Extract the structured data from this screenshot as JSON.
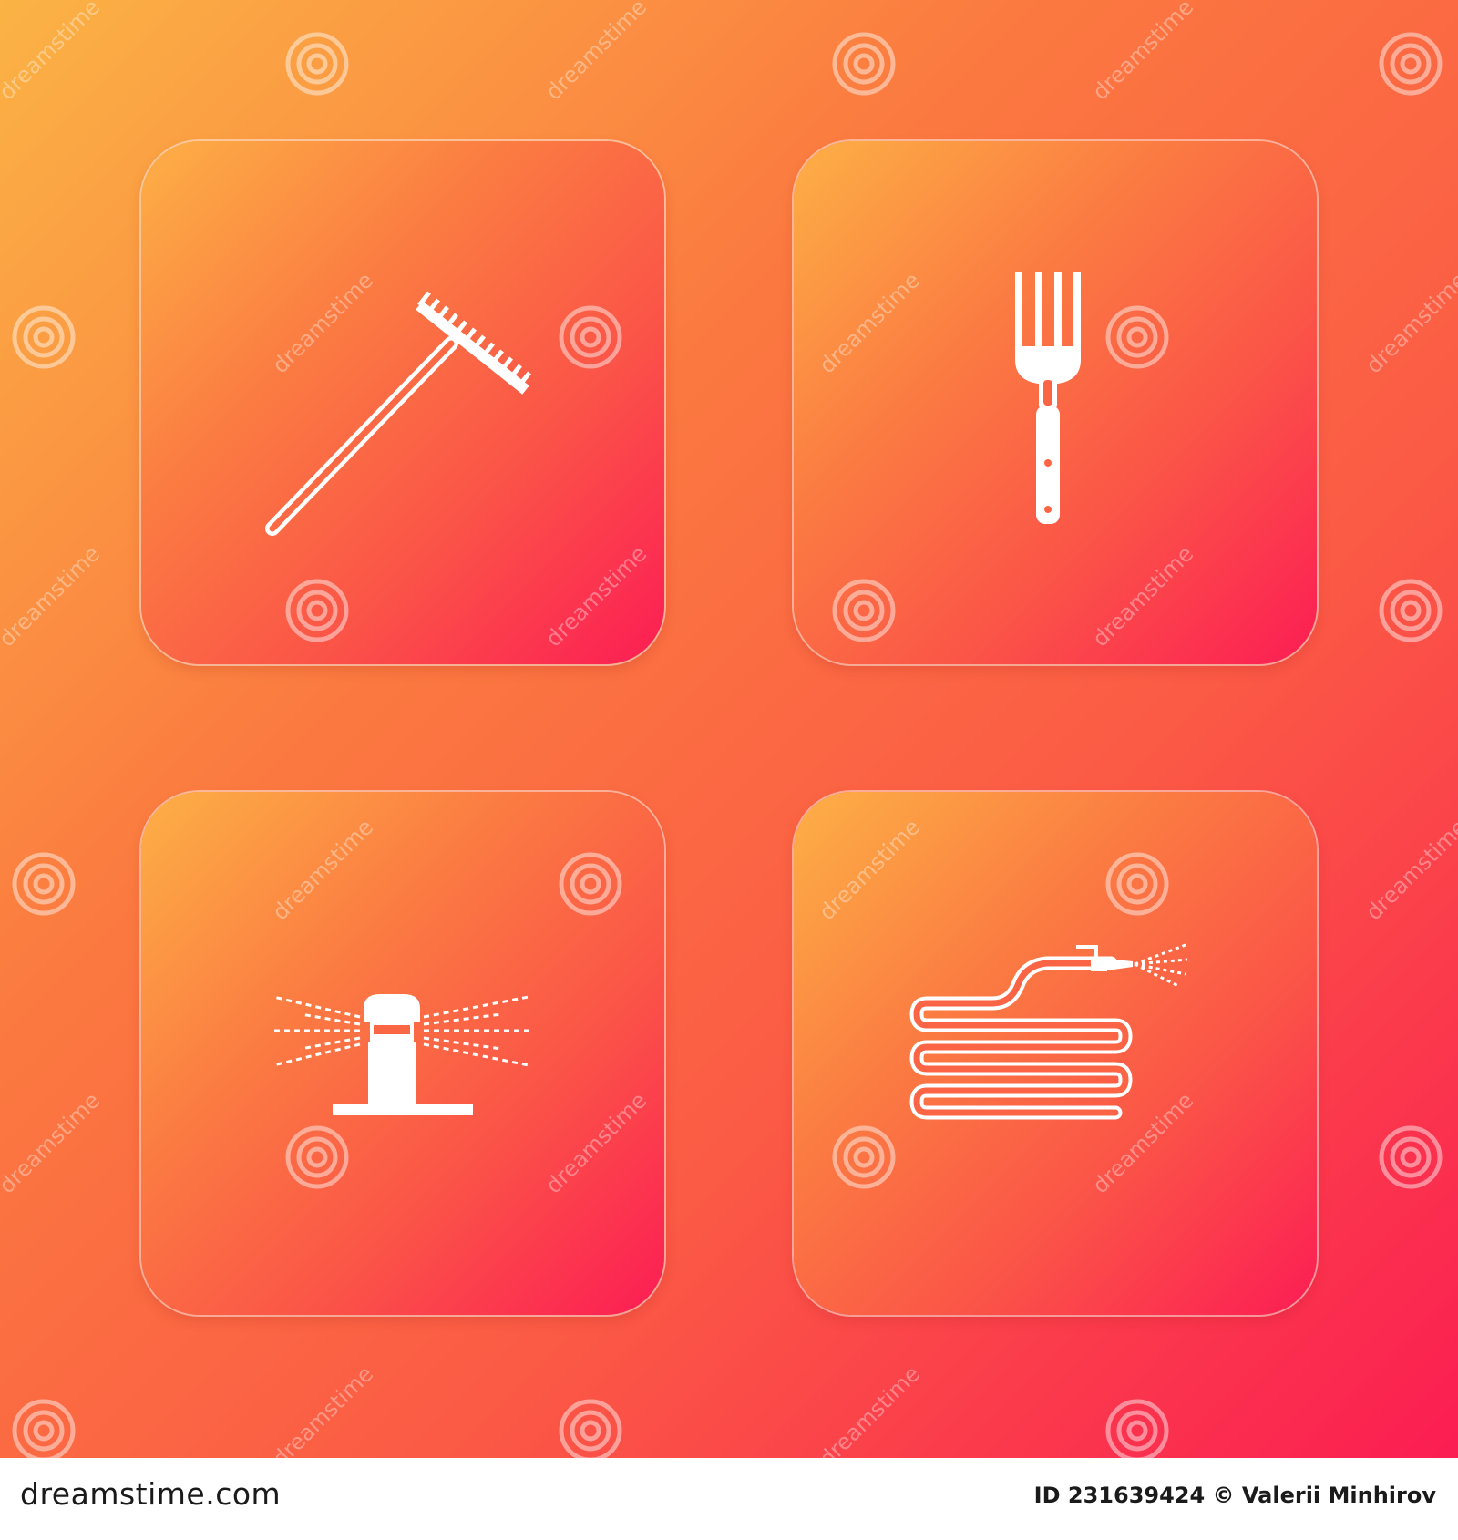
{
  "icons": [
    {
      "name": "rake-icon"
    },
    {
      "name": "garden-fork-icon"
    },
    {
      "name": "sprinkler-icon"
    },
    {
      "name": "garden-hose-icon"
    }
  ],
  "colors": {
    "background_start": "#fbb345",
    "background_end": "#fb1d52",
    "icon": "#ffffff"
  },
  "watermark": {
    "text": "dreamstime"
  },
  "footer": {
    "logo_text": "dreamstime.com",
    "id_label": "ID",
    "id_value": "231639424",
    "copyright": "©",
    "author": "Valerii Minhirov"
  }
}
